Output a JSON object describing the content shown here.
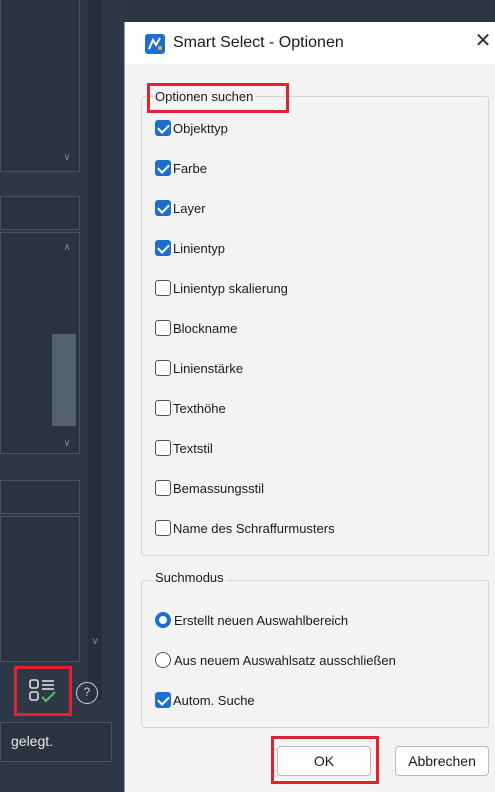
{
  "background": {
    "status_text": "gelegt.",
    "help_label": "?"
  },
  "dialog": {
    "title": "Smart Select - Optionen",
    "close_glyph": "✕",
    "search_group": {
      "legend": "Optionen suchen",
      "options": [
        {
          "label": "Objekttyp",
          "checked": true
        },
        {
          "label": "Farbe",
          "checked": true
        },
        {
          "label": "Layer",
          "checked": true
        },
        {
          "label": "Linientyp",
          "checked": true
        },
        {
          "label": "Linientyp skalierung",
          "checked": false
        },
        {
          "label": "Blockname",
          "checked": false
        },
        {
          "label": "Linienstärke",
          "checked": false
        },
        {
          "label": "Texthöhe",
          "checked": false
        },
        {
          "label": "Textstil",
          "checked": false
        },
        {
          "label": "Bemassungsstil",
          "checked": false
        },
        {
          "label": "Name des Schraffurmusters",
          "checked": false
        }
      ]
    },
    "mode_group": {
      "legend": "Suchmodus",
      "radios": [
        {
          "label": "Erstellt neuen Auswahlbereich",
          "selected": true
        },
        {
          "label": "Aus neuem Auswahlsatz ausschließen",
          "selected": false
        }
      ],
      "auto_search": {
        "label": "Autom. Suche",
        "checked": true
      }
    },
    "buttons": {
      "ok": "OK",
      "cancel": "Abbrechen"
    }
  },
  "colors": {
    "accent": "#1f6fd0",
    "highlight": "#e0242e"
  }
}
